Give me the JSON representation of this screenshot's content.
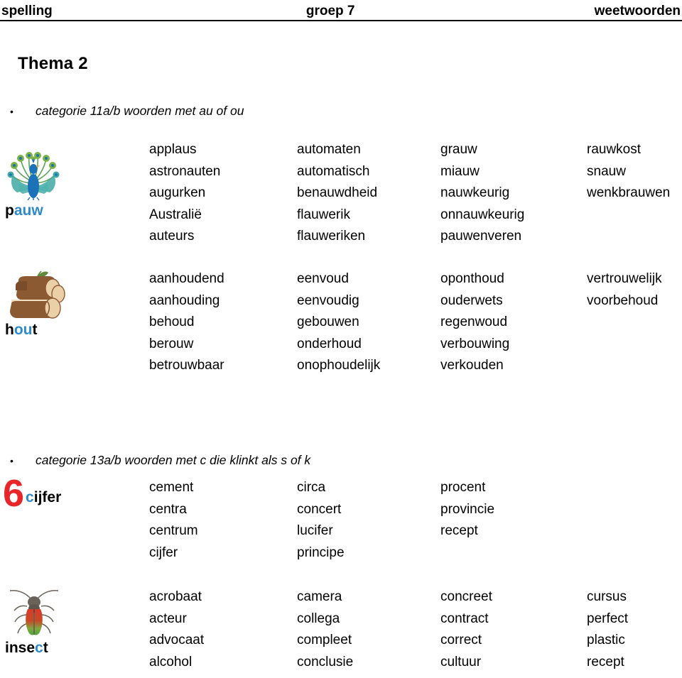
{
  "header": {
    "left": "spelling",
    "middle": "groep 7",
    "right": "weetwoorden"
  },
  "theme_title": "Thema 2",
  "categories": [
    {
      "bullet": "•",
      "label": "categorie 11a/b woorden met au of ou"
    },
    {
      "bullet": "•",
      "label": "categorie 13a/b woorden met c die klinkt als s of k"
    }
  ],
  "word_blocks": [
    {
      "icon": "peacock-icon",
      "icon_label_plain_prefix": "p",
      "icon_label_highlight": "auw",
      "icon_label_plain_suffix": "",
      "icon_label_full": "pauw",
      "columns": [
        [
          "applaus",
          "astronauten",
          "augurken",
          "Australië",
          "auteurs"
        ],
        [
          "automaten",
          "automatisch",
          "benauwdheid",
          "flauwerik",
          "flauweriken"
        ],
        [
          "grauw",
          "miauw",
          "nauwkeurig",
          "onnauwkeurig",
          "pauwenveren"
        ],
        [
          "rauwkost",
          "snauw",
          "wenkbrauwen"
        ]
      ]
    },
    {
      "icon": "log-wood-icon",
      "icon_label_plain_prefix": "h",
      "icon_label_highlight": "ou",
      "icon_label_plain_suffix": "t",
      "icon_label_full": "hout",
      "columns": [
        [
          "aanhoudend",
          "aanhouding",
          "behoud",
          "berouw",
          "betrouwbaar"
        ],
        [
          "eenvoud",
          "eenvoudig",
          "gebouwen",
          "onderhoud",
          "onophoudelijk"
        ],
        [
          "oponthoud",
          "ouderwets",
          "regenwoud",
          "verbouwing",
          "verkouden"
        ],
        [
          "vertrouwelijk",
          "voorbehoud"
        ]
      ]
    },
    {
      "icon": "number-six-icon",
      "big_number": "6",
      "icon_label_plain_prefix": "",
      "icon_label_highlight": "c",
      "icon_label_plain_suffix": "ijfer",
      "icon_label_full": "cijfer",
      "columns": [
        [
          "cement",
          "centra",
          "centrum",
          "cijfer"
        ],
        [
          "circa",
          "concert",
          "lucifer",
          "principe"
        ],
        [
          "procent",
          "provincie",
          "recept"
        ],
        []
      ]
    },
    {
      "icon": "beetle-insect-icon",
      "icon_label_plain_prefix": "inse",
      "icon_label_highlight": "c",
      "icon_label_plain_suffix": "t",
      "icon_label_full": "insect",
      "columns": [
        [
          "acrobaat",
          "acteur",
          "advocaat",
          "alcohol"
        ],
        [
          "camera",
          "collega",
          "compleet",
          "conclusie"
        ],
        [
          "concreet",
          "contract",
          "correct",
          "cultuur"
        ],
        [
          "cursus",
          "perfect",
          "plastic",
          "recept"
        ]
      ]
    }
  ],
  "colors": {
    "highlight_blue": "#2E8ACB",
    "number_red": "#E8262A",
    "text_black": "#000000",
    "wood_brown": "#8B5A32",
    "wood_cream": "#EBCFA6",
    "peacock_blue": "#1B72B8",
    "peacock_green": "#6BA544",
    "peacock_teal": "#3FA9A2"
  }
}
